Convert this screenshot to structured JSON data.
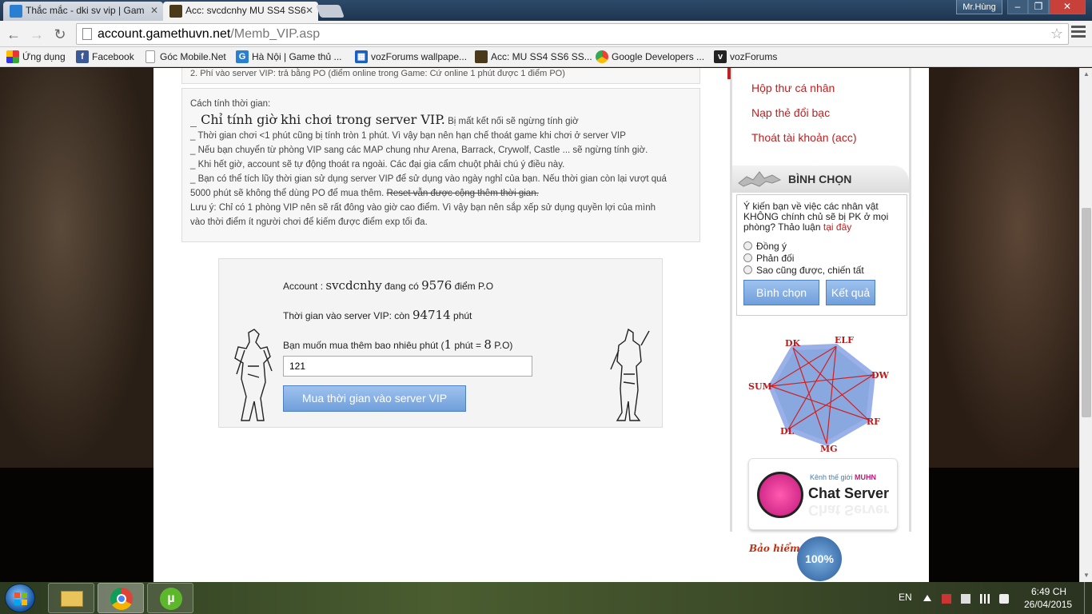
{
  "browser": {
    "tabs": [
      {
        "title": "Thắc mắc - dki sv vip | Gam",
        "favicon": "gamethuvn-icon",
        "active": false
      },
      {
        "title": "Acc: svcdcnhy MU SS4 SS6",
        "favicon": "mu-icon",
        "active": true
      }
    ],
    "user": "Mr.Hùng",
    "url_domain": "account.gamethuvn.net",
    "url_path": "/Memb_VIP.asp"
  },
  "bookmarks": [
    {
      "label": "Ứng dụng",
      "icon": "apps-grid-icon"
    },
    {
      "label": "Facebook",
      "icon": "facebook-icon"
    },
    {
      "label": "Góc Mobile.Net",
      "icon": "page-icon"
    },
    {
      "label": "Hà Nội | Game thủ ...",
      "icon": "gamethuvn-icon"
    },
    {
      "label": "vozForums wallpape...",
      "icon": "vozforums-icon"
    },
    {
      "label": "Acc: MU SS4 SS6 SS...",
      "icon": "mu-icon"
    },
    {
      "label": "Google Developers ...",
      "icon": "google-icon"
    },
    {
      "label": "vozForums",
      "icon": "voz-icon"
    }
  ],
  "main": {
    "partial_rule": "2. Phí vào server VIP: trả bằng PO (điểm online trong Game: Cứ online 1 phút được 1 điểm PO)",
    "time_calc": {
      "heading": "Cách tính thời gian:",
      "big_prefix": "_ Chỉ tính giờ khi chơi trong server VIP.",
      "big_suffix": "Bị mất kết nối sẽ ngừng tính giờ",
      "lines": [
        "_ Thời gian chơi <1 phút cũng bị tính tròn 1 phút. Vì vậy bạn nên hạn chế thoát game khi chơi ở server VIP",
        "_ Nếu bạn chuyển từ phòng VIP sang các MAP chung như Arena, Barrack, Crywolf, Castle ... sẽ ngừng tính giờ.",
        "_ Khi hết giờ, account sẽ tự động thoát ra ngoài. Các đại gia cẩm chuột phải chú ý điều này.",
        "_ Bạn có thể tích lũy thời gian sử dụng server VIP để sử dụng vào ngày nghỉ của bạn. Nếu thời gian còn lại vượt quá"
      ],
      "line5_prefix": "5000 phút sẽ không thể dùng PO để mua thêm.",
      "line5_strike": "Reset vẫn được cộng thêm thời gian.",
      "note_line1": "Lưu ý: Chỉ có 1 phòng VIP nên sẽ rất đông vào giờ cao điểm. Vì vậy bạn nên sắp xếp sử dụng quyền lợi của mình",
      "note_line2": "vào thời điểm ít người chơi để kiếm được điểm exp tối đa."
    },
    "vip_panel": {
      "account_label": "Account :",
      "account_name": "svcdcnhy",
      "has_label": "đang có",
      "points": "9576",
      "points_unit": "điểm P.O",
      "time_label": "Thời gian vào server VIP: còn",
      "minutes_left": "94714",
      "minutes_unit": "phút",
      "buy_question": "Bạn muốn mua thêm bao nhiêu phút (",
      "rate_minutes": "1",
      "rate_mid": "phút =",
      "rate_points": "8",
      "rate_end": "P.O)",
      "input_value": "121",
      "buy_button": "Mua thời gian vào server VIP"
    }
  },
  "sidebar": {
    "links": [
      "Hộp thư cá nhân",
      "Nạp thẻ đổi bạc",
      "Thoát tài khoản (acc)"
    ],
    "vote": {
      "title": "BÌNH CHỌN",
      "question": "Ý kiến bạn về việc các nhân vật KHÔNG chính chủ sẽ bị PK ở mọi phòng? Thảo luận",
      "link": "tại đây",
      "options": [
        "Đồng ý",
        "Phản đối",
        "Sao cũng được, chiến tất"
      ],
      "vote_button": "Bình chọn",
      "result_button": "Kết quả"
    },
    "classes": [
      "DK",
      "ELF",
      "DW",
      "RF",
      "MG",
      "DL",
      "SUM"
    ],
    "chat_banner": {
      "sub": "Kênh thế giới",
      "sub_brand": "MUHN",
      "title": "Chat Server"
    },
    "insurance": {
      "text": "Bảo hiểm đồ",
      "seal": "100%"
    }
  },
  "taskbar": {
    "language": "EN",
    "time": "6:49 CH",
    "date": "26/04/2015",
    "apps": [
      "explorer-icon",
      "chrome-icon",
      "utorrent-icon"
    ]
  },
  "colors": {
    "accent_red": "#c02020",
    "button_blue": "#6f9fdb"
  }
}
